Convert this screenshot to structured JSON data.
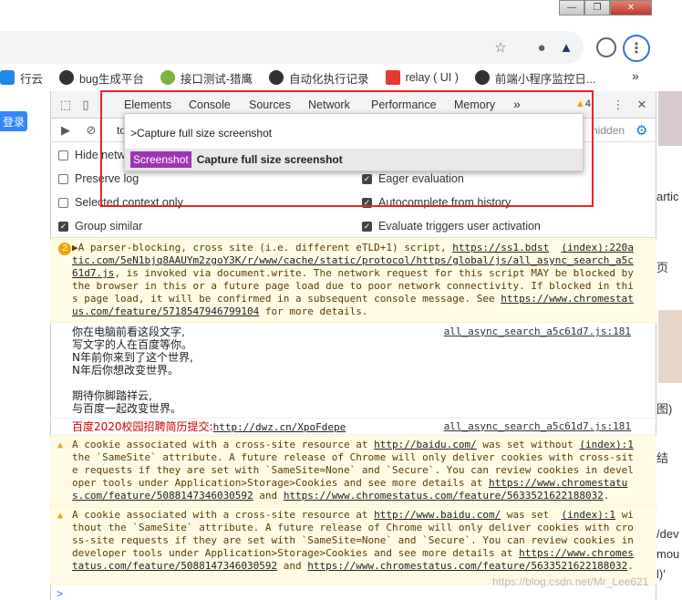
{
  "window": {
    "min": "—",
    "max": "❐",
    "close": "✕"
  },
  "bookmarks": [
    {
      "label": "行云",
      "color": "#1e88e5"
    },
    {
      "label": "bug生成平台",
      "color": "#333333"
    },
    {
      "label": "接口测试-猎鹰",
      "color": "#7cb342"
    },
    {
      "label": "自动化执行记录",
      "color": "#333333"
    },
    {
      "label": "relay ( UI )",
      "color": "#e53935"
    },
    {
      "label": "前端小程序监控日...",
      "color": "#333333"
    }
  ],
  "bookmarks_more": "»",
  "page": {
    "login": "登录"
  },
  "right_sliver": [
    "artic",
    "页",
    "图)",
    "结",
    "/dev",
    "mou",
    "l)'"
  ],
  "devtools": {
    "tabs": [
      "Elements",
      "Console",
      "Sources",
      "Network",
      "Performance",
      "Memory"
    ],
    "more": "»",
    "warn_count": "4",
    "hidden": "hidden",
    "filter_prefix": "to",
    "settings_left": [
      {
        "label": "Hide network",
        "checked": false
      },
      {
        "label": "Preserve log",
        "checked": false
      },
      {
        "label": "Selected context only",
        "checked": false
      },
      {
        "label": "Group similar",
        "checked": true
      }
    ],
    "settings_right": [
      {
        "label": "Eager evaluation",
        "checked": true
      },
      {
        "label": "Autocomplete from history",
        "checked": true
      },
      {
        "label": "Evaluate triggers user activation",
        "checked": true
      }
    ]
  },
  "command_menu": {
    "input": ">Capture full size screenshot",
    "badge": "Screenshot",
    "item": "Capture full size screenshot"
  },
  "messages": {
    "warn1": {
      "count": "2",
      "text_a": "▶A parser-blocking, cross site (i.e. different eTLD+1) script, ",
      "link1": "https://ss1.bdst",
      "src1": "(index):220",
      "link1b": "atic.com/5eN1bjq8AAUYm2zgoY3K/r/www/cache/static/protocol/https/global/js/all_async_search_a5c61d7.js",
      "text_b": ", is invoked via document.write. The network request for this script MAY be blocked by the browser in this or a future page load due to poor network connectivity. If blocked in this page load, it will be confirmed in a subsequent console message. See ",
      "link2": "https://www.chromestatus.com/feature/5718547946799104",
      "text_c": " for more details."
    },
    "log1": {
      "lines": [
        "你在电脑前看这段文字,",
        "写文字的人在百度等你。",
        "N年前你来到了这个世界,",
        "N年后你想改变世界。",
        "",
        "期待你脚踏祥云,",
        "与百度一起改变世界。"
      ],
      "src": "all_async_search_a5c61d7.js:181"
    },
    "log2": {
      "label": "百度2020校园招聘简历提交:",
      "link": "http://dwz.cn/XpoFdepe",
      "src": "all_async_search_a5c61d7.js:181"
    },
    "warn2": {
      "text_a": "A cookie associated with a cross-site resource at ",
      "link1": "http://baidu.com/",
      "text_b": " was set without ",
      "src": "(index):1",
      "text_c": "the `SameSite` attribute. A future release of Chrome will only deliver cookies with cross-site requests if they are set with `SameSite=None` and `Secure`. You can review cookies in developer tools under Application>Storage>Cookies and see more details at ",
      "link2": "https://www.chromestatus.com/feature/5088147346030592",
      "text_d": " and ",
      "link3": "https://www.chromestatus.com/feature/5633521622188032",
      "text_e": "."
    },
    "warn3": {
      "text_a": "A cookie associated with a cross-site resource at ",
      "link1": "http://www.baidu.com/",
      "text_b": " was set ",
      "src": "(index):1",
      "text_c": "without the `SameSite` attribute. A future release of Chrome will only deliver cookies with cross-site requests if they are set with `SameSite=None` and `Secure`. You can review cookies in developer tools under Application>Storage>Cookies and see more details at ",
      "link2": "https://www.chromestatus.com/feature/5088147346030592",
      "text_d": " and ",
      "link3": "https://www.chromestatus.com/feature/5633521622188032",
      "text_e": "."
    }
  },
  "prompt": ">",
  "watermark": "https://blog.csdn.net/Mr_Lee621"
}
